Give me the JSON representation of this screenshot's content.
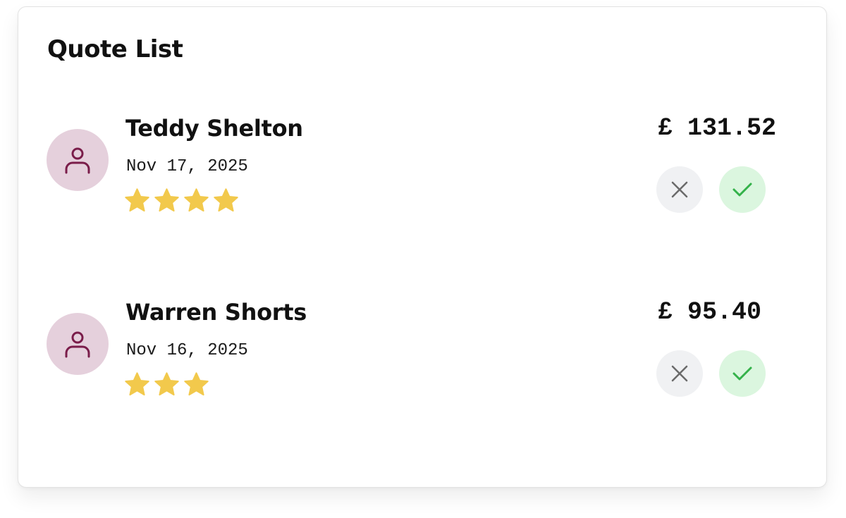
{
  "title": "Quote List",
  "currency_symbol": "£",
  "colors": {
    "avatar_bg": "#e5d0dc",
    "avatar_icon": "#7a1d4a",
    "star": "#f2c94c",
    "reject_bg": "#f0f1f3",
    "reject_icon": "#6b6b6b",
    "accept_bg": "#dbf6df",
    "accept_icon": "#34b24a"
  },
  "quotes": [
    {
      "name": "Teddy Shelton",
      "date": "Nov 17, 2025",
      "rating": 4,
      "price": "£ 131.52"
    },
    {
      "name": "Warren Shorts",
      "date": "Nov 16, 2025",
      "rating": 3,
      "price": "£ 95.40"
    }
  ],
  "icons": {
    "avatar": "user-icon",
    "rating": "star-icon",
    "reject": "close-icon",
    "accept": "check-icon"
  }
}
